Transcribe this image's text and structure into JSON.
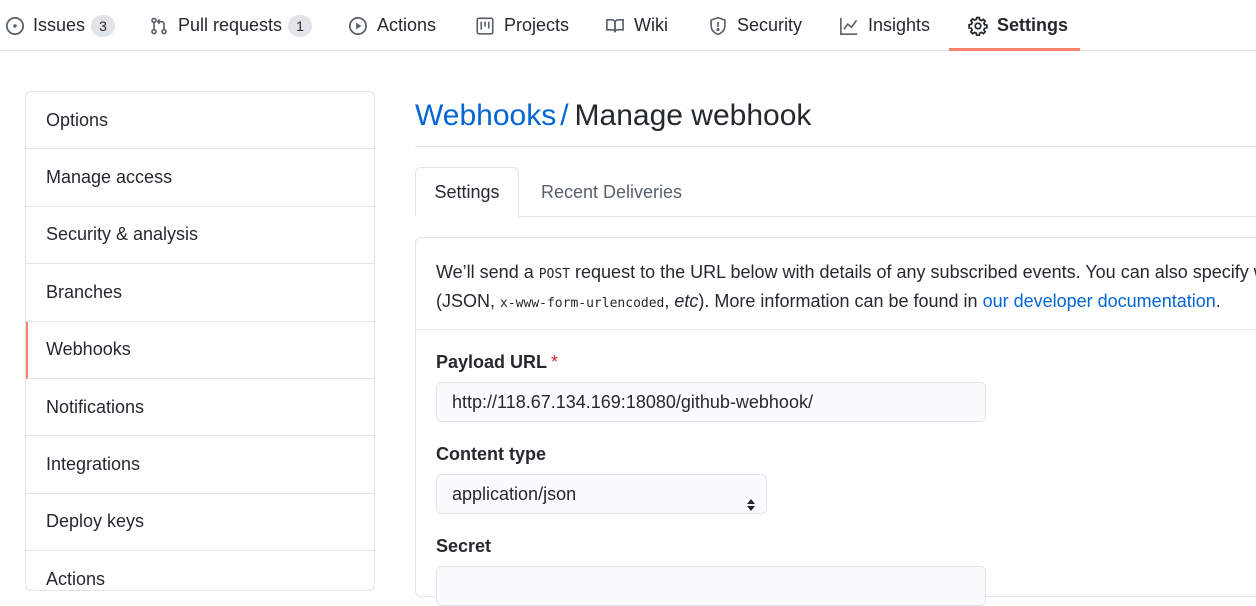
{
  "nav": {
    "issues": {
      "label": "Issues",
      "count": "3"
    },
    "pull_requests": {
      "label": "Pull requests",
      "count": "1"
    },
    "actions": {
      "label": "Actions"
    },
    "projects": {
      "label": "Projects"
    },
    "wiki": {
      "label": "Wiki"
    },
    "security": {
      "label": "Security"
    },
    "insights": {
      "label": "Insights"
    },
    "settings": {
      "label": "Settings"
    },
    "selected": "Settings",
    "accent_color": "#f9826c"
  },
  "menu": {
    "items": [
      {
        "label": "Options"
      },
      {
        "label": "Manage access"
      },
      {
        "label": "Security & analysis"
      },
      {
        "label": "Branches"
      },
      {
        "label": "Webhooks"
      },
      {
        "label": "Notifications"
      },
      {
        "label": "Integrations"
      },
      {
        "label": "Deploy keys"
      },
      {
        "label": "Actions"
      }
    ],
    "selected": "Webhooks"
  },
  "page": {
    "breadcrumb": "Webhooks",
    "separator": "/",
    "title": "Manage webhook"
  },
  "tabs": {
    "settings": "Settings",
    "recent_deliveries": "Recent Deliveries",
    "active": "Settings"
  },
  "intro": {
    "part1": "We’ll send a ",
    "code1": "POST",
    "part2": " request to the URL below with details of any subscribed events. You can also specify whic",
    "part3": "(JSON, ",
    "code2": "x-www-form-urlencoded",
    "part4": ", ",
    "etc": "etc",
    "part5": "). More information can be found in ",
    "link": "our developer documentation",
    "part6": "."
  },
  "form": {
    "payload_url": {
      "label": "Payload URL",
      "required_mark": "*",
      "value": "http://118.67.134.169:18080/github-webhook/"
    },
    "content_type": {
      "label": "Content type",
      "value": "application/json"
    },
    "secret": {
      "label": "Secret",
      "value": ""
    }
  },
  "colors": {
    "link": "#0366d6",
    "text": "#24292e",
    "muted": "#586069",
    "required": "#cb2431",
    "border": "#e1e4e8"
  }
}
